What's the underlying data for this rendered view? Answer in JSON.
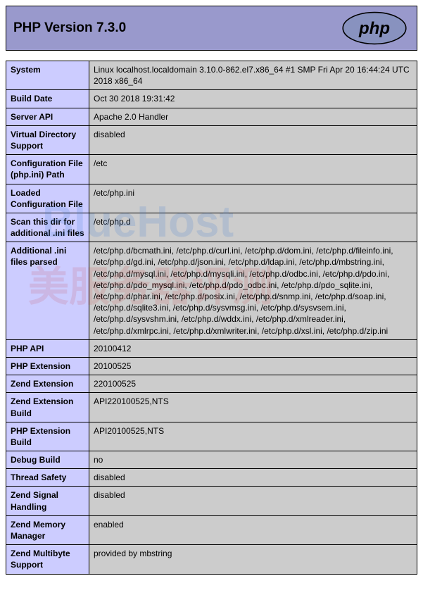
{
  "header": {
    "title_prefix": "PHP Version ",
    "version": "7.3.0"
  },
  "rows": [
    {
      "k": "System",
      "v": "Linux localhost.localdomain 3.10.0-862.el7.x86_64 #1 SMP Fri Apr 20 16:44:24 UTC 2018 x86_64"
    },
    {
      "k": "Build Date",
      "v": "Oct 30 2018 19:31:42"
    },
    {
      "k": "Server API",
      "v": "Apache 2.0 Handler"
    },
    {
      "k": "Virtual Directory Support",
      "v": "disabled"
    },
    {
      "k": "Configuration File (php.ini) Path",
      "v": "/etc"
    },
    {
      "k": "Loaded Configuration File",
      "v": "/etc/php.ini"
    },
    {
      "k": "Scan this dir for additional .ini files",
      "v": "/etc/php.d"
    },
    {
      "k": "Additional .ini files parsed",
      "v": "/etc/php.d/bcmath.ini, /etc/php.d/curl.ini, /etc/php.d/dom.ini, /etc/php.d/fileinfo.ini, /etc/php.d/gd.ini, /etc/php.d/json.ini, /etc/php.d/ldap.ini, /etc/php.d/mbstring.ini, /etc/php.d/mysql.ini, /etc/php.d/mysqli.ini, /etc/php.d/odbc.ini, /etc/php.d/pdo.ini, /etc/php.d/pdo_mysql.ini, /etc/php.d/pdo_odbc.ini, /etc/php.d/pdo_sqlite.ini, /etc/php.d/phar.ini, /etc/php.d/posix.ini, /etc/php.d/snmp.ini, /etc/php.d/soap.ini, /etc/php.d/sqlite3.ini, /etc/php.d/sysvmsg.ini, /etc/php.d/sysvsem.ini, /etc/php.d/sysvshm.ini, /etc/php.d/wddx.ini, /etc/php.d/xmlreader.ini, /etc/php.d/xmlrpc.ini, /etc/php.d/xmlwriter.ini, /etc/php.d/xsl.ini, /etc/php.d/zip.ini"
    },
    {
      "k": "PHP API",
      "v": "20100412"
    },
    {
      "k": "PHP Extension",
      "v": "20100525"
    },
    {
      "k": "Zend Extension",
      "v": "220100525"
    },
    {
      "k": "Zend Extension Build",
      "v": "API220100525,NTS"
    },
    {
      "k": "PHP Extension Build",
      "v": "API20100525,NTS"
    },
    {
      "k": "Debug Build",
      "v": "no"
    },
    {
      "k": "Thread Safety",
      "v": "disabled"
    },
    {
      "k": "Zend Signal Handling",
      "v": "disabled"
    },
    {
      "k": "Zend Memory Manager",
      "v": "enabled"
    },
    {
      "k": "Zend Multibyte Support",
      "v": "provided by mbstring"
    }
  ],
  "watermark": {
    "line1": "BlueHost",
    "line2": "美服务器评测"
  }
}
